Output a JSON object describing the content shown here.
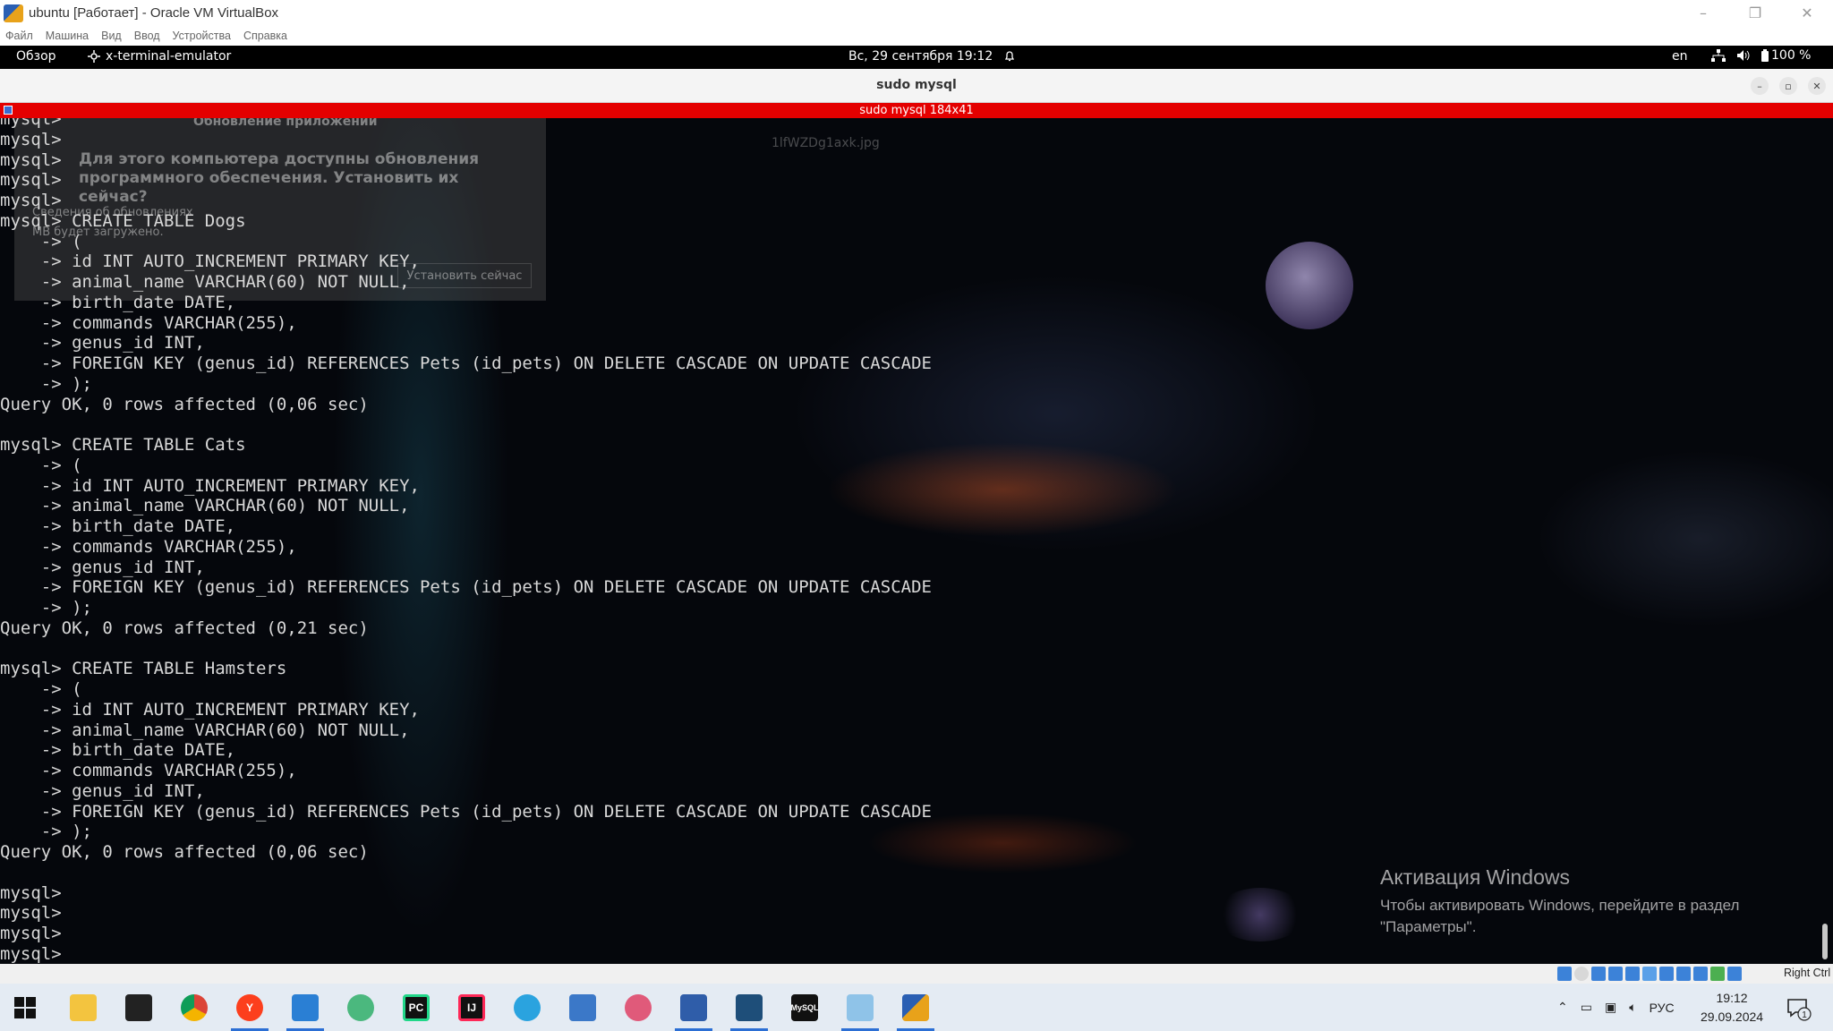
{
  "host_window": {
    "title": "ubuntu [Работает] - Oracle VM VirtualBox",
    "controls": {
      "minimize": "–",
      "restore": "❐",
      "close": "✕"
    },
    "menu": [
      "Файл",
      "Машина",
      "Вид",
      "Ввод",
      "Устройства",
      "Справка"
    ]
  },
  "gnome_topbar": {
    "activities": "Обзор",
    "app_name": "x-terminal-emulator",
    "clock": "Вс, 29 сентября  19:12",
    "keyboard_layout": "en",
    "battery": "100 %"
  },
  "terminal": {
    "title": "sudo mysql",
    "tab_label": "sudo mysql 184x41",
    "controls": {
      "minimize": "–",
      "maximize": "▫",
      "close": "✕"
    },
    "lines": [
      "mysql>",
      "mysql>",
      "mysql>",
      "mysql>",
      "mysql>",
      "mysql> CREATE TABLE Dogs",
      "    -> (",
      "    -> id INT AUTO_INCREMENT PRIMARY KEY,",
      "    -> animal_name VARCHAR(60) NOT NULL,",
      "    -> birth_date DATE,",
      "    -> commands VARCHAR(255),",
      "    -> genus_id INT,",
      "    -> FOREIGN KEY (genus_id) REFERENCES Pets (id_pets) ON DELETE CASCADE ON UPDATE CASCADE",
      "    -> );",
      "Query OK, 0 rows affected (0,06 sec)",
      "",
      "mysql> CREATE TABLE Cats",
      "    -> (",
      "    -> id INT AUTO_INCREMENT PRIMARY KEY,",
      "    -> animal_name VARCHAR(60) NOT NULL,",
      "    -> birth_date DATE,",
      "    -> commands VARCHAR(255),",
      "    -> genus_id INT,",
      "    -> FOREIGN KEY (genus_id) REFERENCES Pets (id_pets) ON DELETE CASCADE ON UPDATE CASCADE",
      "    -> );",
      "Query OK, 0 rows affected (0,21 sec)",
      "",
      "mysql> CREATE TABLE Hamsters",
      "    -> (",
      "    -> id INT AUTO_INCREMENT PRIMARY KEY,",
      "    -> animal_name VARCHAR(60) NOT NULL,",
      "    -> birth_date DATE,",
      "    -> commands VARCHAR(255),",
      "    -> genus_id INT,",
      "    -> FOREIGN KEY (genus_id) REFERENCES Pets (id_pets) ON DELETE CASCADE ON UPDATE CASCADE",
      "    -> );",
      "Query OK, 0 rows affected (0,06 sec)",
      "",
      "mysql>",
      "mysql>",
      "mysql>",
      "mysql>"
    ]
  },
  "background_ghost": {
    "dialog_title": "Обновление приложений",
    "dialog_heading": "Для этого компьютера доступны обновления программного обеспечения. Установить их сейчас?",
    "details": "Сведения об обновлениях",
    "size_note": "MB будет загружено.",
    "install_button": "Установить сейчас",
    "filename": "1lfWZDg1axk.jpg"
  },
  "activation": {
    "title": "Активация Windows",
    "text": "Чтобы активировать Windows, перейдите в раздел \"Параметры\"."
  },
  "vbox_status": {
    "host_key": "Right Ctrl"
  },
  "taskbar": {
    "apps": [
      {
        "name": "file-explorer",
        "label": ""
      },
      {
        "name": "terminal",
        "label": ""
      },
      {
        "name": "chrome",
        "label": ""
      },
      {
        "name": "yandex-browser",
        "label": "Y"
      },
      {
        "name": "vscode",
        "label": ""
      },
      {
        "name": "atom",
        "label": ""
      },
      {
        "name": "pycharm",
        "label": "PC"
      },
      {
        "name": "intellij",
        "label": "IJ"
      },
      {
        "name": "telegram",
        "label": ""
      },
      {
        "name": "calculator",
        "label": ""
      },
      {
        "name": "snipping-tool",
        "label": ""
      },
      {
        "name": "virtualbox",
        "label": ""
      },
      {
        "name": "mysql-workbench",
        "label": ""
      },
      {
        "name": "mysql-cli",
        "label": "MySQL"
      },
      {
        "name": "notepad",
        "label": ""
      },
      {
        "name": "virtualbox-vm",
        "label": ""
      }
    ],
    "input_language": "РУС",
    "time": "19:12",
    "date": "29.09.2024",
    "notification_count": "1"
  },
  "colors": {
    "terminal_tab_bar": "#e40000",
    "taskbar": "#e4ebf3",
    "terminal_text": "#d8d8d8"
  }
}
